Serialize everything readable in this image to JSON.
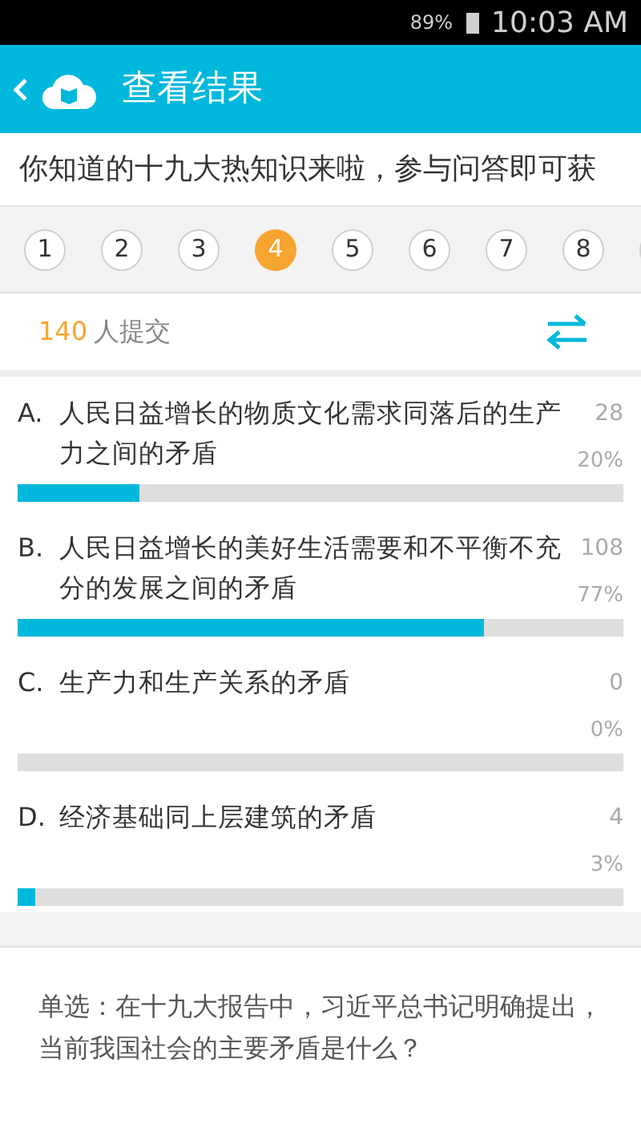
{
  "status_bar": {
    "battery": "89%",
    "time": "10:03 AM"
  },
  "header": {
    "title": "查看结果"
  },
  "marquee": "你知道的十九大热知识来啦，参与问答即可获",
  "question_tabs": [
    {
      "label": "1",
      "selected": false
    },
    {
      "label": "2",
      "selected": false
    },
    {
      "label": "3",
      "selected": false
    },
    {
      "label": "4",
      "selected": true
    },
    {
      "label": "5",
      "selected": false
    },
    {
      "label": "6",
      "selected": false
    },
    {
      "label": "7",
      "selected": false
    },
    {
      "label": "8",
      "selected": false
    }
  ],
  "submissions": {
    "count": "140",
    "label": "人提交"
  },
  "options": [
    {
      "letter": "A.",
      "text": "人民日益增长的物质文化需求同落后的生产力之间的矛盾",
      "count": "28",
      "percent": "20%",
      "level": 0.2
    },
    {
      "letter": "B.",
      "text": "人民日益增长的美好生活需要和不平衡不充分的发展之间的矛盾",
      "count": "108",
      "percent": "77%",
      "level": 0.77
    },
    {
      "letter": "C.",
      "text": "生产力和生产关系的矛盾",
      "count": "0",
      "percent": "0%"
    },
    {
      "letter": "D.",
      "text": "经济基础同上层建筑的矛盾",
      "count": "4",
      "percent": "3%",
      "level": 0.03
    }
  ],
  "question": "单选：在十九大报告中，习近平总书记明确提出，当前我国社会的主要矛盾是什么？"
}
